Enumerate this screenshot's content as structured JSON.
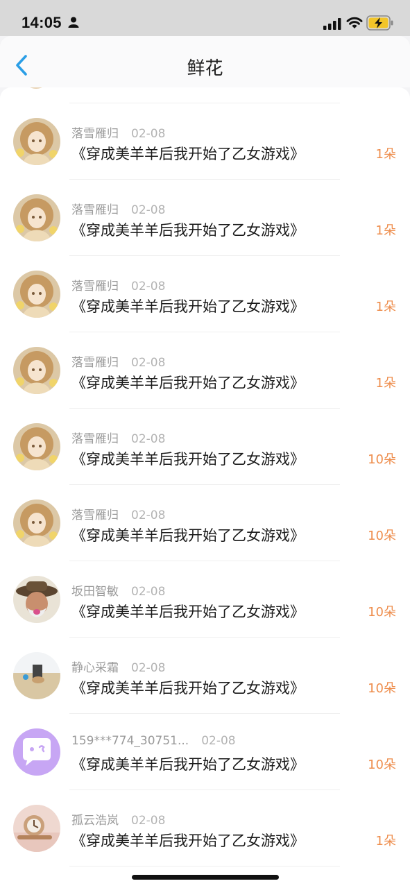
{
  "status_bar": {
    "time": "14:05"
  },
  "header": {
    "title": "鲜花"
  },
  "colors": {
    "amount": "#ee8d4c",
    "accent_back": "#2a9ee6"
  },
  "records": [
    {
      "avatar": "anime-girl",
      "user": "落雪雁归",
      "date": "02-08",
      "book": "《穿成美羊羊后我开始了乙女游戏》",
      "amount": "1朵"
    },
    {
      "avatar": "anime-girl",
      "user": "落雪雁归",
      "date": "02-08",
      "book": "《穿成美羊羊后我开始了乙女游戏》",
      "amount": "1朵"
    },
    {
      "avatar": "anime-girl",
      "user": "落雪雁归",
      "date": "02-08",
      "book": "《穿成美羊羊后我开始了乙女游戏》",
      "amount": "1朵"
    },
    {
      "avatar": "anime-girl",
      "user": "落雪雁归",
      "date": "02-08",
      "book": "《穿成美羊羊后我开始了乙女游戏》",
      "amount": "1朵"
    },
    {
      "avatar": "anime-girl",
      "user": "落雪雁归",
      "date": "02-08",
      "book": "《穿成美羊羊后我开始了乙女游戏》",
      "amount": "10朵"
    },
    {
      "avatar": "anime-girl",
      "user": "落雪雁归",
      "date": "02-08",
      "book": "《穿成美羊羊后我开始了乙女游戏》",
      "amount": "10朵"
    },
    {
      "avatar": "old-man-hat",
      "user": "坂田智敏",
      "date": "02-08",
      "book": "《穿成美羊羊后我开始了乙女游戏》",
      "amount": "10朵"
    },
    {
      "avatar": "beach-scene",
      "user": "静心采霜",
      "date": "02-08",
      "book": "《穿成美羊羊后我开始了乙女游戏》",
      "amount": "10朵"
    },
    {
      "avatar": "chat-bubble",
      "user": "159***774_30751...",
      "date": "02-08",
      "book": "《穿成美羊羊后我开始了乙女游戏》",
      "amount": "10朵"
    },
    {
      "avatar": "watch-photo",
      "user": "孤云浩岚",
      "date": "02-08",
      "book": "《穿成美羊羊后我开始了乙女游戏》",
      "amount": "1朵"
    }
  ]
}
